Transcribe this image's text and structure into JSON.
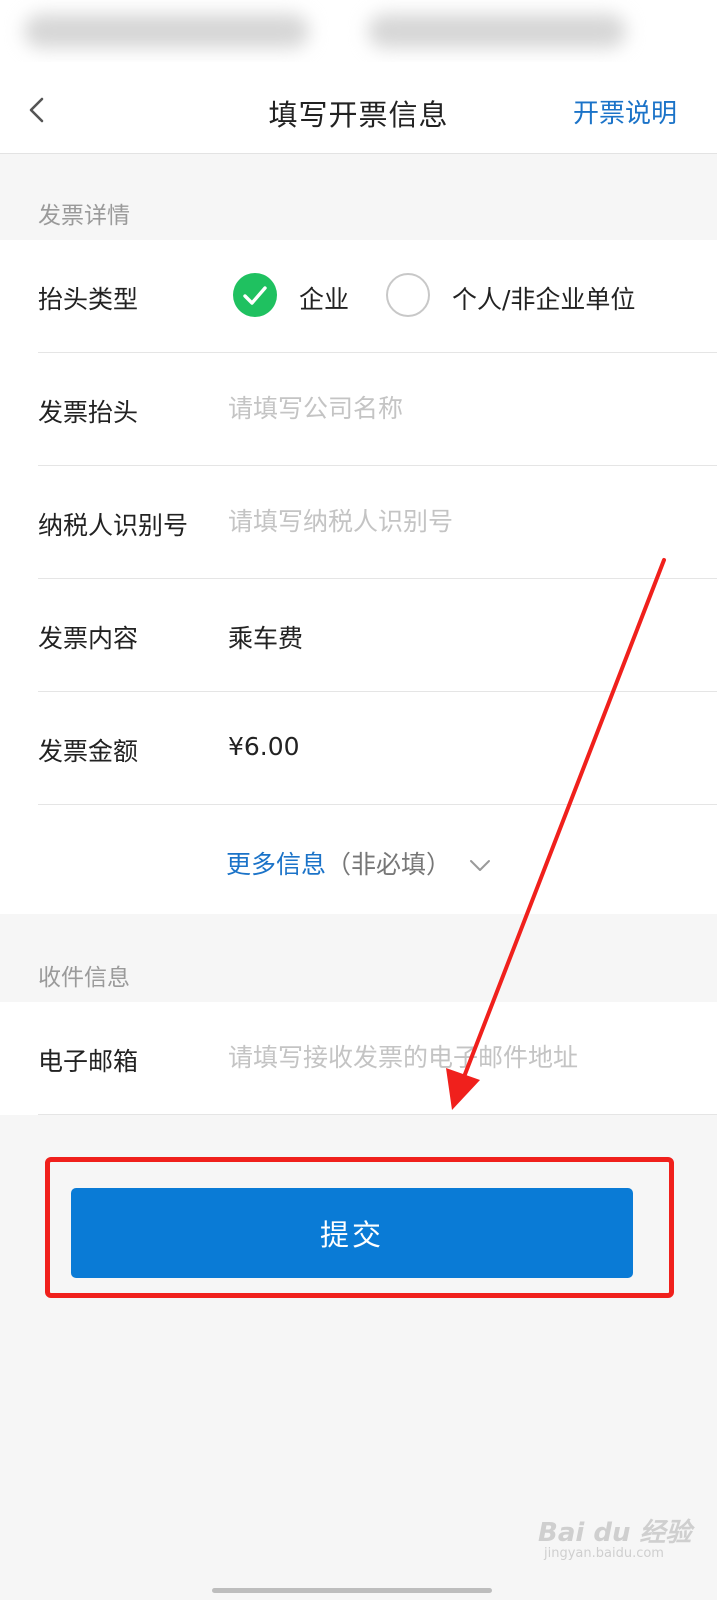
{
  "nav": {
    "title": "填写开票信息",
    "help_link": "开票说明"
  },
  "invoice_section": {
    "title": "发票详情",
    "header_type": {
      "label": "抬头类型",
      "options": [
        {
          "label": "企业",
          "selected": true
        },
        {
          "label": "个人/非企业单位",
          "selected": false
        }
      ]
    },
    "invoice_title": {
      "label": "发票抬头",
      "placeholder": "请填写公司名称",
      "value": ""
    },
    "tax_id": {
      "label": "纳税人识别号",
      "placeholder": "请填写纳税人识别号",
      "value": ""
    },
    "content": {
      "label": "发票内容",
      "value": "乘车费"
    },
    "amount": {
      "label": "发票金额",
      "value": "¥6.00"
    },
    "more_info": {
      "label": "更多信息",
      "note": "（非必填）"
    }
  },
  "receive_section": {
    "title": "收件信息",
    "email": {
      "label": "电子邮箱",
      "placeholder": "请填写接收发票的电子邮件地址",
      "value": ""
    }
  },
  "submit_label": "提交",
  "watermark": {
    "text": "Bai du 经验",
    "sub": "jingyan.baidu.com"
  },
  "colors": {
    "accent": "#1b73c8",
    "button": "#0a7bd6",
    "check": "#1fc160",
    "annotation": "#f0201c"
  }
}
